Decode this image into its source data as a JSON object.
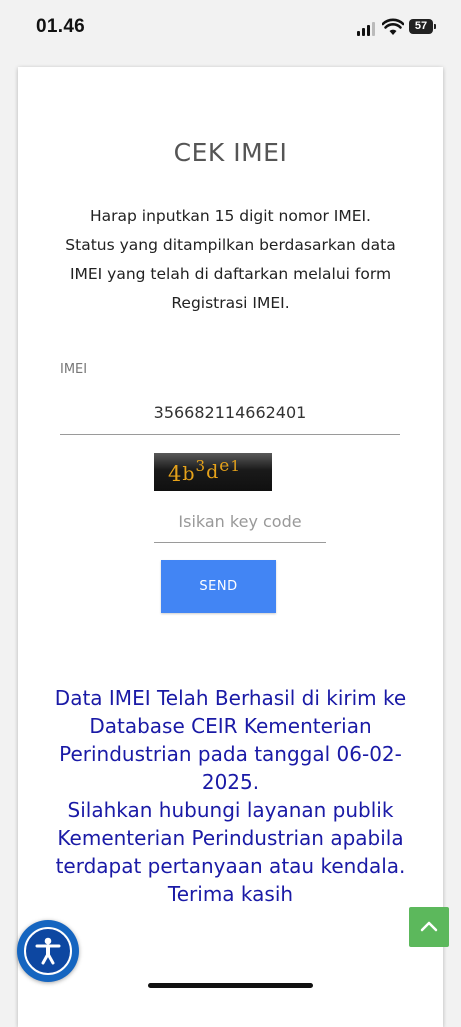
{
  "status_bar": {
    "time": "01.46",
    "battery": "57"
  },
  "page": {
    "title": "CEK IMEI",
    "intro_lines": [
      "Harap inputkan 15 digit nomor IMEI.",
      "Status yang ditampilkan berdasarkan data",
      "IMEI yang telah di daftarkan melalui form",
      "Registrasi IMEI."
    ]
  },
  "form": {
    "imei_label": "IMEI",
    "imei_value": "356682114662401",
    "captcha_text": "4b3de1",
    "keycode_placeholder": "Isikan key code",
    "send_label": "SEND"
  },
  "result": {
    "message_lines": [
      "Data IMEI Telah Berhasil di kirim ke",
      "Database CEIR Kementerian",
      "Perindustrian pada tanggal 06-02-",
      "2025."
    ],
    "contact_lines": [
      "Silahkan hubungi layanan publik",
      "Kementerian Perindustrian apabila",
      "terdapat pertanyaan atau kendala.",
      "Terima kasih"
    ]
  },
  "colors": {
    "send_button": "#4285f4",
    "result_text": "#1a1aa6",
    "scroll_top_button": "#5cb85c",
    "accessibility_button": "#1565c0"
  },
  "icons": {
    "accessibility": "accessibility-icon",
    "scroll_top": "chevron-up-icon",
    "signal": "signal-icon",
    "wifi": "wifi-icon",
    "battery": "battery-icon"
  }
}
